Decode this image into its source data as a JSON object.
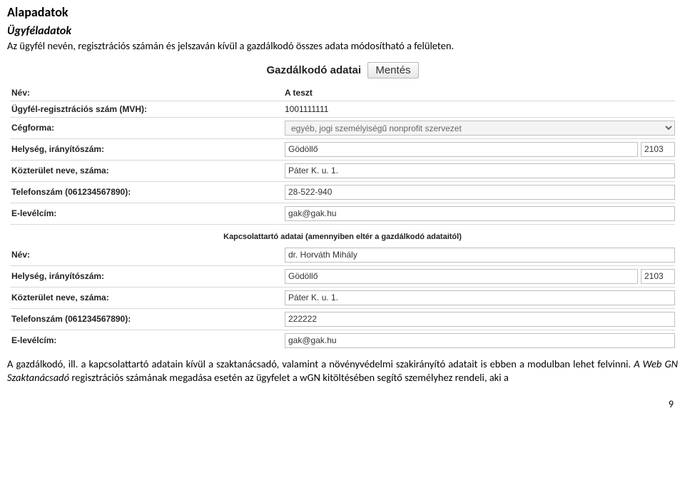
{
  "doc": {
    "section_title": "Alapadatok",
    "subsection_title": "Ügyféladatok",
    "intro": "Az ügyfél nevén, regisztrációs számán és jelszaván kívül a gazdálkodó összes adata módosítható a felületen.",
    "outro_before": "A gazdálkodó, ill. a kapcsolattartó adatain kívül a szaktanácsadó, valamint a növényvédelmi szakirányító adatait is ebben a modulban lehet felvinni. ",
    "outro_italic": "A Web GN Szaktanácsadó",
    "outro_after": " regisztrációs számának megadása esetén az ügyfelet a wGN kitöltésében segítő személyhez rendeli, aki a",
    "page_num": "9"
  },
  "panel": {
    "title": "Gazdálkodó adatai",
    "save_label": "Mentés",
    "contact_header": "Kapcsolattartó adatai (amennyiben eltér a gazdálkodó adataitól)"
  },
  "labels": {
    "nev": "Név:",
    "regszam": "Ügyfél-regisztrációs szám (MVH):",
    "cegforma": "Cégforma:",
    "helyseg": "Helység, irányítószám:",
    "kozterulet": "Közterület neve, száma:",
    "telefon": "Telefonszám (061234567890):",
    "email": "E-levélcím:"
  },
  "vals": {
    "nev": "A teszt",
    "regszam": "1001111111",
    "cegforma": "egyéb, jogi személyiségű nonprofit szervezet",
    "helyseg": "Gödöllő",
    "irsz": "2103",
    "kozterulet": "Páter K. u. 1.",
    "telefon": "28-522-940",
    "email": "gak@gak.hu",
    "c_nev": "dr. Horváth Mihály",
    "c_helyseg": "Gödöllő",
    "c_irsz": "2103",
    "c_kozterulet": "Páter K. u. 1.",
    "c_telefon": "222222",
    "c_email": "gak@gak.hu"
  }
}
